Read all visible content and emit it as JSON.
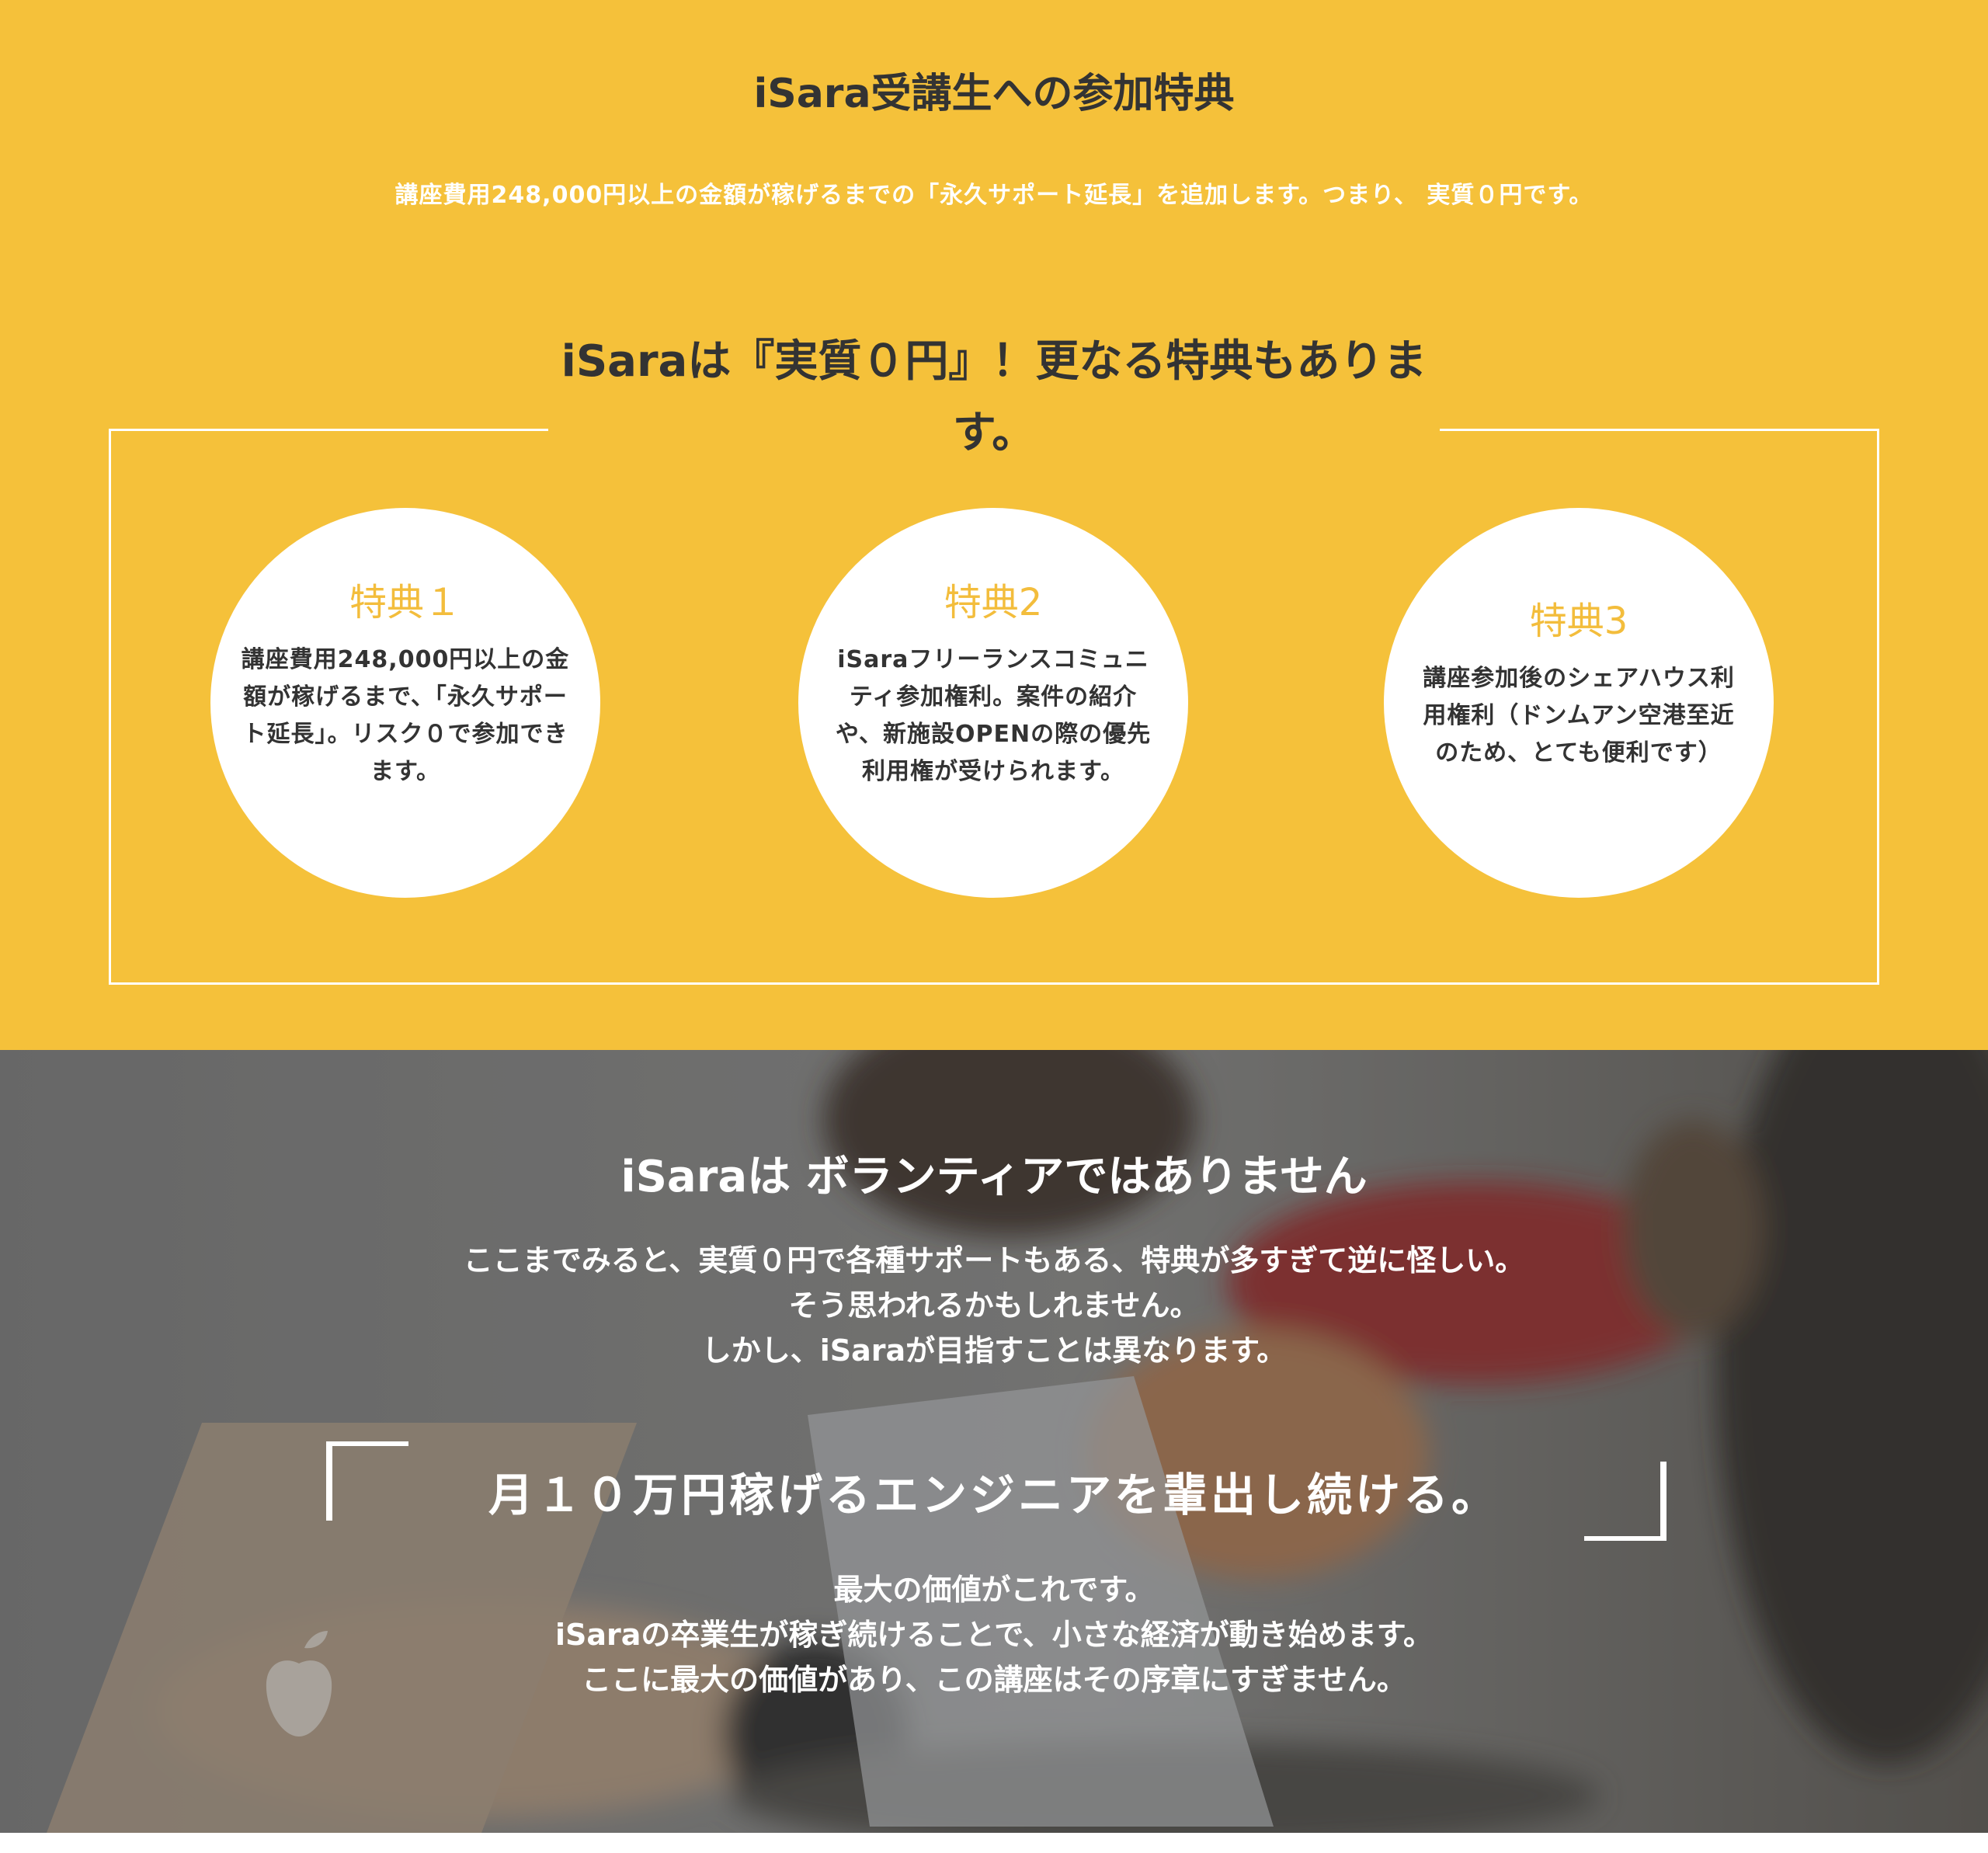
{
  "benefits_section": {
    "title": "iSara受講生への参加特典",
    "lead": "講座費用248,000円以上の金額が稼げるまでの「永久サポート延長」を追加します。つまり、 実質０円です。",
    "box_title": "iSaraは『実質０円』！更なる特典もあります。",
    "items": [
      {
        "label": "特典１",
        "text": "講座費用248,000円以上の金額が稼げるまで、「永久サポート延長」。リスク０で参加できます。"
      },
      {
        "label": "特典2",
        "text": "iSaraフリーランスコミュニティ参加権利。案件の紹介や、新施設OPENの際の優先利用権が受けられます。"
      },
      {
        "label": "特典3",
        "text": "講座参加後のシェアハウス利用権利（ドンムアン空港至近のため、とても便利です）"
      }
    ],
    "colors": {
      "background": "#f5c13a",
      "accent": "#f3bd3c",
      "heading": "#333333"
    }
  },
  "philosophy_section": {
    "title": "iSaraは ボランティアではありません",
    "lines": [
      "ここまでみると、実質０円で各種サポートもある、特典が多すぎて逆に怪しい。",
      "そう思われるかもしれません。",
      "しかし、iSaraが目指すことは異なります。"
    ],
    "quote": "月１０万円稼げるエンジニアを輩出し続ける。",
    "closing_lines": [
      "最大の価値がこれです。",
      "iSaraの卒業生が稼ぎ続けることで、小さな経済が動き始めます。",
      "ここに最大の価値があり、この講座はその序章にすぎません。"
    ],
    "background_image": "blurred-cafe-laptop-photo"
  }
}
